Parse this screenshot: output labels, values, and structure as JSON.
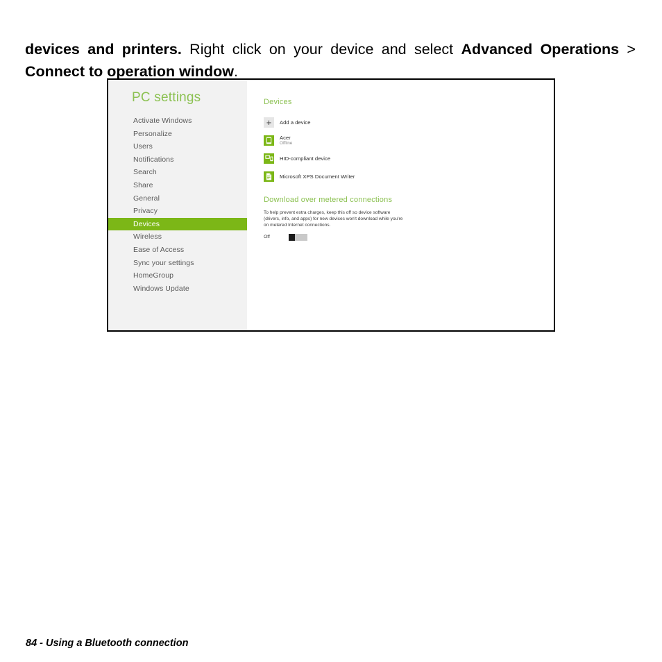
{
  "paragraph": {
    "segment_1_bold": "devices and printers.",
    "segment_2_plain": " Right click on your device and select ",
    "segment_3_bold": "Advanced Operations",
    "segment_4_plain": " > ",
    "segment_5_bold": "Connect to operation window",
    "segment_6_plain": "."
  },
  "screenshot": {
    "sidebar": {
      "title": "PC settings",
      "title_color": "#8cc152",
      "selected_color": "#7cb717",
      "items": [
        {
          "label": "Activate Windows",
          "selected": false
        },
        {
          "label": "Personalize",
          "selected": false
        },
        {
          "label": "Users",
          "selected": false
        },
        {
          "label": "Notifications",
          "selected": false
        },
        {
          "label": "Search",
          "selected": false
        },
        {
          "label": "Share",
          "selected": false
        },
        {
          "label": "General",
          "selected": false
        },
        {
          "label": "Privacy",
          "selected": false
        },
        {
          "label": "Devices",
          "selected": true
        },
        {
          "label": "Wireless",
          "selected": false
        },
        {
          "label": "Ease of Access",
          "selected": false
        },
        {
          "label": "Sync your settings",
          "selected": false
        },
        {
          "label": "HomeGroup",
          "selected": false
        },
        {
          "label": "Windows Update",
          "selected": false
        }
      ]
    },
    "content": {
      "devices_heading": "Devices",
      "devices": [
        {
          "icon": "plus-icon",
          "name": "Add a device",
          "sub": ""
        },
        {
          "icon": "phone-icon",
          "name": "Acer",
          "sub": "Offline"
        },
        {
          "icon": "hid-device-icon",
          "name": "HID-compliant device",
          "sub": ""
        },
        {
          "icon": "document-writer-icon",
          "name": "Microsoft XPS Document Writer",
          "sub": ""
        }
      ],
      "metered": {
        "heading": "Download over metered connections",
        "description": "To help prevent extra charges, keep this off so device software (drivers, info, and apps) for new devices won't download while you're on metered Internet connections.",
        "toggle_label": "Off",
        "toggle_state": "off"
      }
    }
  },
  "footer": {
    "text": "84 - Using a Bluetooth connection"
  }
}
